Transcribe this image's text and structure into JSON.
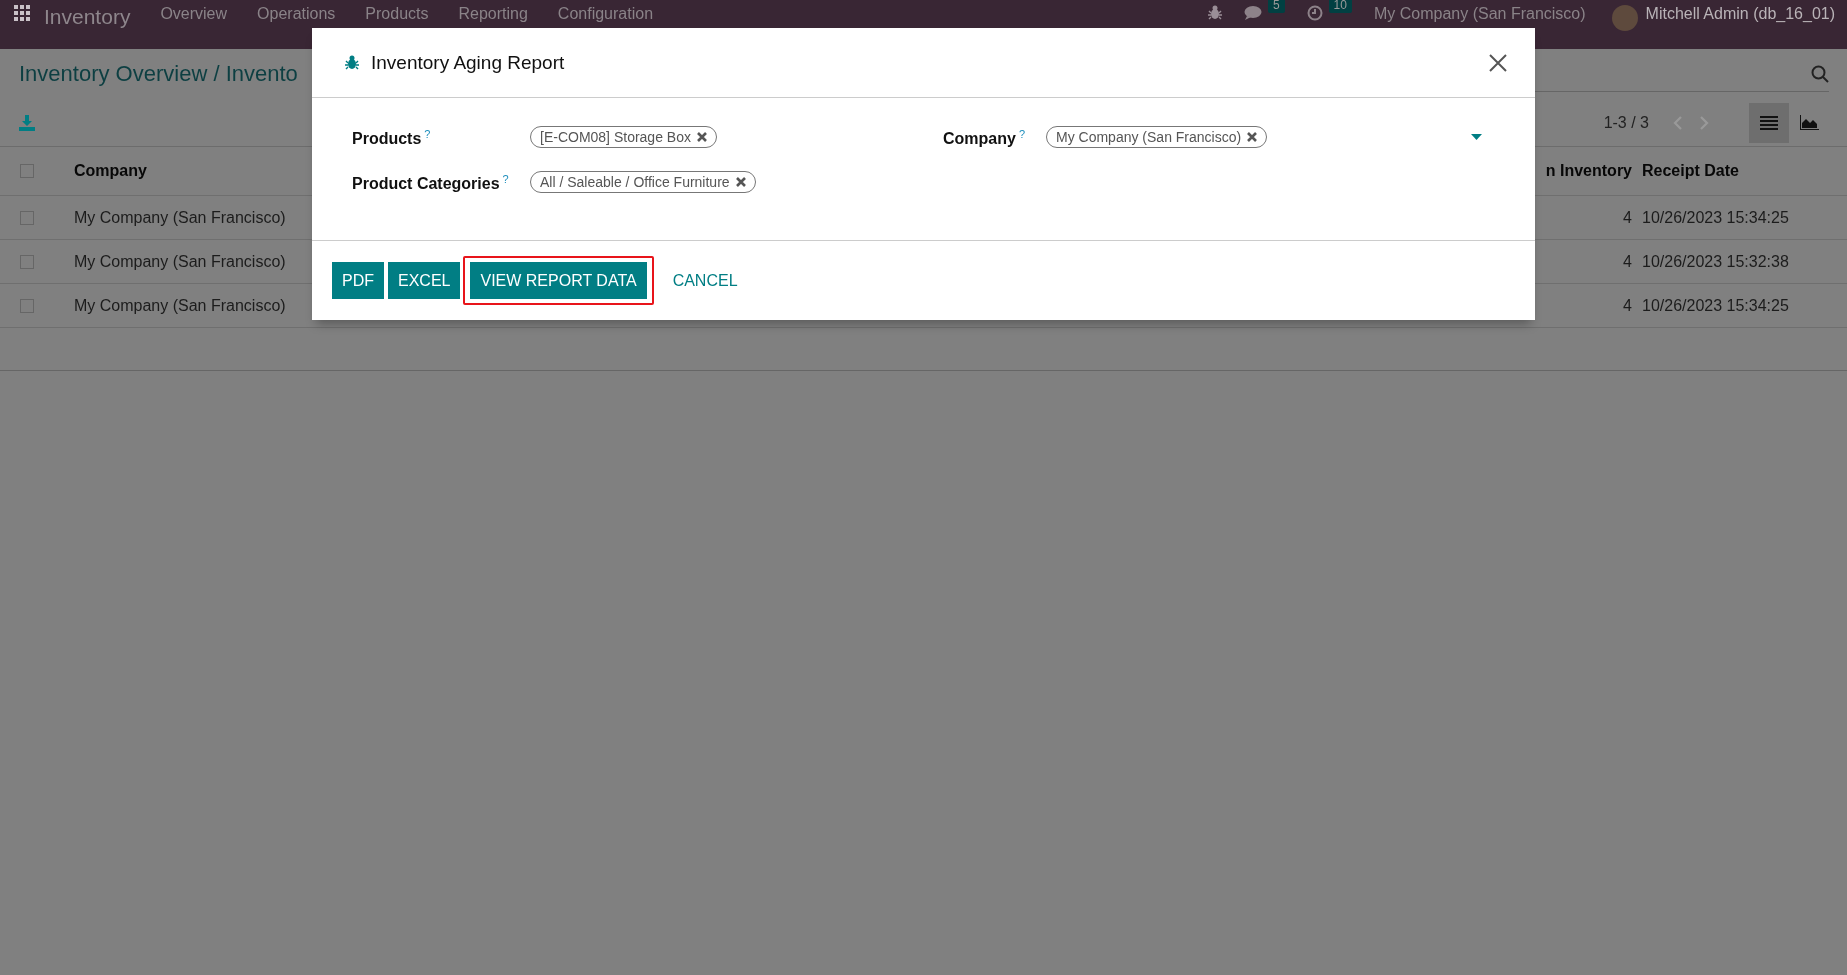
{
  "navbar": {
    "app_name": "Inventory",
    "menu": [
      "Overview",
      "Operations",
      "Products",
      "Reporting",
      "Configuration"
    ],
    "messages_count": "5",
    "activities_count": "10",
    "company": "My Company (San Francisco)",
    "user": "Mitchell Admin (db_16_01)"
  },
  "breadcrumb": "Inventory Overview / Invento",
  "pager": "1-3 / 3",
  "views": [
    {
      "kind": "list",
      "selected": true
    },
    {
      "kind": "graph",
      "selected": false
    }
  ],
  "table": {
    "header_checked": false,
    "columns": [
      "Company",
      "n Inventory",
      "Receipt Date"
    ],
    "rows": [
      {
        "checked": false,
        "company": "My Company (San Francisco)",
        "inventory": "4",
        "receipt_date": "10/26/2023 15:34:25"
      },
      {
        "checked": false,
        "company": "My Company (San Francisco)",
        "inventory": "4",
        "receipt_date": "10/26/2023 15:32:38"
      },
      {
        "checked": false,
        "company": "My Company (San Francisco)",
        "inventory": "4",
        "receipt_date": "10/26/2023 15:34:25"
      }
    ]
  },
  "dialog": {
    "title": "Inventory Aging Report",
    "fields": [
      {
        "label": "Products",
        "help_mark": "?",
        "tags": [
          "[E-COM08] Storage Box"
        ],
        "dropdown": false
      },
      {
        "label": "Company",
        "help_mark": "?",
        "tags": [
          "My Company (San Francisco)"
        ],
        "dropdown": true
      },
      {
        "label": "Product Categories",
        "help_mark": "?",
        "tags": [
          "All / Saleable / Office Furniture"
        ],
        "dropdown": false
      }
    ],
    "buttons": [
      {
        "label": "PDF",
        "kind": "primary",
        "highlighted": false
      },
      {
        "label": "EXCEL",
        "kind": "primary",
        "highlighted": false
      },
      {
        "label": "VIEW REPORT DATA",
        "kind": "primary",
        "highlighted": true
      },
      {
        "label": "CANCEL",
        "kind": "link",
        "highlighted": false
      }
    ]
  }
}
